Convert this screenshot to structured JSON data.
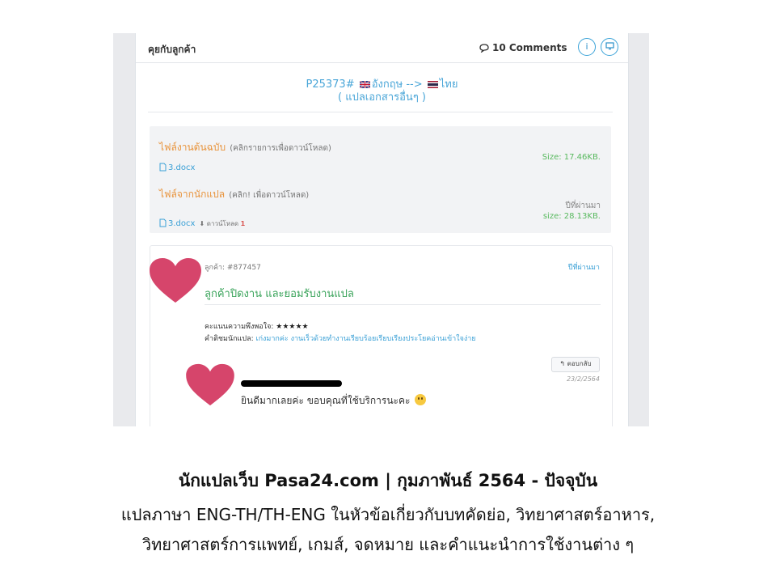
{
  "panel": {
    "title": "คุยกับลูกค้า",
    "comments": "10 Comments",
    "info_icon": "info-icon",
    "monitor_icon": "monitor-icon"
  },
  "order": {
    "id": "P25373#",
    "from": "อังกฤษ",
    "arrow": "-->",
    "to": "ไทย",
    "type": "( แปลเอกสารอื่นๆ )"
  },
  "files": {
    "original": {
      "title": "ไฟล์งานต้นฉบับ",
      "hint": "(คลิกรายการเพื่อดาวน์โหลด)",
      "filename": "3.docx",
      "size": "Size: 17.46KB."
    },
    "translated": {
      "title": "ไฟล์จากนักแปล",
      "hint": "(คลิก! เพื่อดาวน์โหลด)",
      "filename": "3.docx",
      "download_label": "ดาวน์โหลด",
      "download_count": "1",
      "time": "ปีที่ผ่านมา",
      "size": "size: 28.13KB."
    }
  },
  "comment": {
    "customer": "ลูกค้า: #877457",
    "time": "ปีที่ผ่านมา",
    "message": "ลูกค้าปิดงาน และยอมรับงานแปล",
    "rating_label": "คะแนนความพึงพอใจ:",
    "rating_stars": "★★★★★",
    "rating_value": 5,
    "remark_label": "คำติชมนักแปล:",
    "remark_text": "เก่งมากค่ะ งานเร็วด้วยทำงานเรียบร้อยเรียบเรียงประโยคอ่านเข้าใจง่าย",
    "reply_button": "ตอบกลับ",
    "reply_date": "23/2/2564",
    "reply_text": "ยินดีมากเลยค่ะ ขอบคุณที่ใช้บริการนะคะ"
  },
  "colors": {
    "accent": "#3aa0d6",
    "orange": "#e8933b",
    "green": "#39a35a",
    "heart": "#d6456b"
  },
  "caption": {
    "line1": "นักแปลเว็บ Pasa24.com  | กุมภาพันธ์ 2564 - ปัจจุบัน",
    "line2": "แปลภาษา ENG-TH/TH-ENG ในหัวข้อเกี่ยวกับบทคัดย่อ, วิทยาศาสตร์อาหาร,",
    "line3": "วิทยาศาสตร์การแพทย์, เกมส์, จดหมาย และคำแนะนำการใช้งานต่าง ๆ"
  }
}
